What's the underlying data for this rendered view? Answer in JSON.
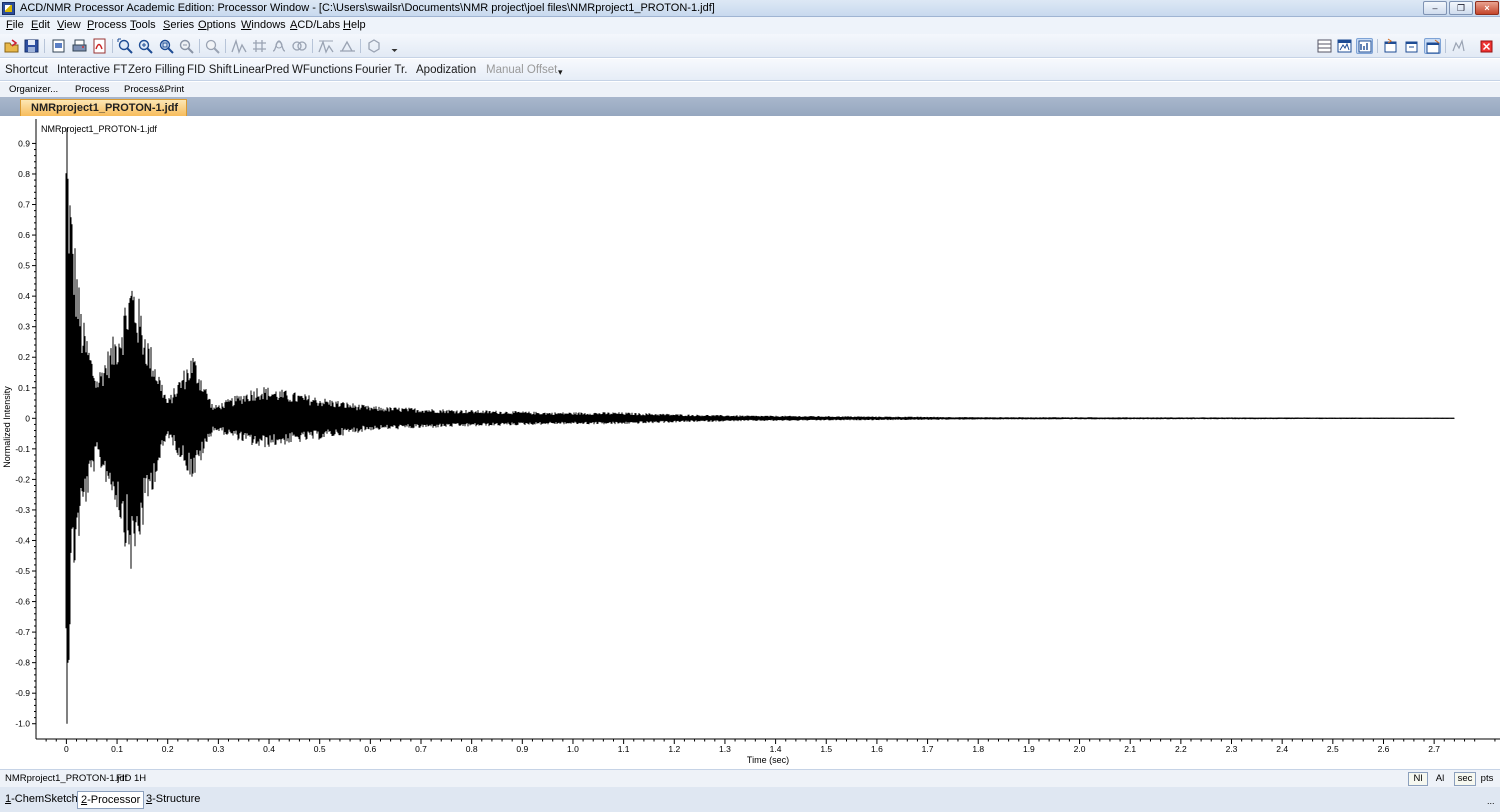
{
  "window": {
    "title": "ACD/NMR Processor Academic Edition: Processor Window - [C:\\Users\\swailsr\\Documents\\NMR project\\joel files\\NMRproject1_PROTON-1.jdf]",
    "minimize_symbol": "–",
    "restore_symbol": "❐",
    "close_symbol": "×"
  },
  "menu": [
    {
      "acc": "F",
      "rest": "ile"
    },
    {
      "acc": "E",
      "rest": "dit"
    },
    {
      "acc": "V",
      "rest": "iew"
    },
    {
      "acc": "P",
      "rest": "rocess"
    },
    {
      "acc": "T",
      "rest": "ools"
    },
    {
      "acc": "S",
      "rest": "eries"
    },
    {
      "acc": "O",
      "rest": "ptions"
    },
    {
      "acc": "W",
      "rest": "indows"
    },
    {
      "acc": "A",
      "rest": "CD/Labs"
    },
    {
      "acc": "H",
      "rest": "elp"
    }
  ],
  "toolbar": {
    "icons": [
      "open-icon",
      "save-icon",
      "print-preview-icon",
      "print-icon",
      "pdf-icon",
      "zoom-fit-icon",
      "zoom-in-icon",
      "zoom-region-icon",
      "zoom-out-icon",
      "zoom-icon",
      "peak-pick-icon",
      "grid-icon",
      "integrate-icon",
      "multiplet-icon",
      "phase-icon",
      "baseline-icon",
      "structure-icon",
      "more-icon"
    ],
    "right_icons": [
      "table-view-icon",
      "window-view-icon",
      "spectrum-view-icon",
      "layout-1-icon",
      "layout-2-icon",
      "layout-3-icon",
      "settings-icon",
      "close-doc-icon"
    ]
  },
  "commands": {
    "shortcut": "Shortcut",
    "interactive_ft": "Interactive FT",
    "zero_filling": "Zero Filling",
    "fid_shift": "FID Shift",
    "linear_pred": "LinearPred",
    "wfunctions": "WFunctions",
    "fourier_tr": "Fourier Tr.",
    "apodization": "Apodization",
    "manual_offset": "Manual Offset",
    "overflow_symbol": "▾"
  },
  "subbar": {
    "organizer": "Organizer...",
    "process": "Process",
    "process_print": "Process&Print"
  },
  "doc_tab": "NMRproject1_PROTON-1.jdf",
  "status": {
    "file": "NMRproject1_PROTON-1.jdf",
    "type": "FID",
    "nucleus": "1H",
    "buttons": {
      "nl": "Nl",
      "al": "Al",
      "sec": "sec",
      "pts": "pts"
    }
  },
  "bottom_tabs": [
    {
      "acc": "1",
      "rest": "-ChemSketch"
    },
    {
      "acc": "2",
      "rest": "-Processor"
    },
    {
      "acc": "3",
      "rest": "-Structure"
    }
  ],
  "bottom_ellipsis": "...",
  "chart_data": {
    "type": "line",
    "title": "NMRproject1_PROTON-1.jdf",
    "xlabel": "Time (sec)",
    "ylabel": "Normalized Intensity",
    "xlim": [
      -0.06,
      2.83
    ],
    "ylim": [
      -1.05,
      0.98
    ],
    "x_ticks": [
      0,
      0.1,
      0.2,
      0.3,
      0.4,
      0.5,
      0.6,
      0.7,
      0.8,
      0.9,
      1.0,
      1.1,
      1.2,
      1.3,
      1.4,
      1.5,
      1.6,
      1.7,
      1.8,
      1.9,
      2.0,
      2.1,
      2.2,
      2.3,
      2.4,
      2.5,
      2.6,
      2.7
    ],
    "x_tick_labels": [
      "0",
      "0.1",
      "0.2",
      "0.3",
      "0.4",
      "0.5",
      "0.6",
      "0.7",
      "0.8",
      "0.9",
      "1.0",
      "1.1",
      "1.2",
      "1.3",
      "1.4",
      "1.5",
      "1.6",
      "1.7",
      "1.8",
      "1.9",
      "2.0",
      "2.1",
      "2.2",
      "2.3",
      "2.4",
      "2.5",
      "2.6",
      "2.7"
    ],
    "y_ticks": [
      0.9,
      0.8,
      0.7,
      0.6,
      0.5,
      0.4,
      0.3,
      0.2,
      0.1,
      0,
      -0.1,
      -0.2,
      -0.3,
      -0.4,
      -0.5,
      -0.6,
      -0.7,
      -0.8,
      -0.9,
      -1.0
    ],
    "y_tick_labels": [
      "0.9",
      "0.8",
      "0.7",
      "0.6",
      "0.5",
      "0.4",
      "0.3",
      "0.2",
      "0.1",
      "0",
      "-0.1",
      "-0.2",
      "-0.3",
      "-0.4",
      "-0.5",
      "-0.6",
      "-0.7",
      "-0.8",
      "-0.9",
      "-1.0"
    ],
    "series": [
      {
        "color": "#000000",
        "x_start": 0.0,
        "x_end": 2.74,
        "envelope": [
          {
            "x": 0.002,
            "top": 0.95,
            "bottom": -1.0
          },
          {
            "x": 0.01,
            "top": 0.72,
            "bottom": -0.58
          },
          {
            "x": 0.03,
            "top": 0.35,
            "bottom": -0.35
          },
          {
            "x": 0.06,
            "top": 0.14,
            "bottom": -0.14
          },
          {
            "x": 0.1,
            "top": 0.3,
            "bottom": -0.3
          },
          {
            "x": 0.13,
            "top": 0.49,
            "bottom": -0.53
          },
          {
            "x": 0.16,
            "top": 0.28,
            "bottom": -0.3
          },
          {
            "x": 0.2,
            "top": 0.06,
            "bottom": -0.06
          },
          {
            "x": 0.25,
            "top": 0.22,
            "bottom": -0.21
          },
          {
            "x": 0.29,
            "top": 0.04,
            "bottom": -0.04
          },
          {
            "x": 0.38,
            "top": 0.11,
            "bottom": -0.1
          },
          {
            "x": 0.5,
            "top": 0.07,
            "bottom": -0.07
          },
          {
            "x": 0.6,
            "top": 0.04,
            "bottom": -0.04
          },
          {
            "x": 0.75,
            "top": 0.03,
            "bottom": -0.03
          },
          {
            "x": 0.96,
            "top": 0.02,
            "bottom": -0.02
          },
          {
            "x": 1.09,
            "top": 0.02,
            "bottom": -0.02
          },
          {
            "x": 1.22,
            "top": 0.013,
            "bottom": -0.013
          },
          {
            "x": 1.35,
            "top": 0.009,
            "bottom": -0.009
          },
          {
            "x": 1.8,
            "top": 0.004,
            "bottom": -0.004
          },
          {
            "x": 2.74,
            "top": 0.002,
            "bottom": -0.002
          }
        ]
      }
    ],
    "grid": false
  }
}
